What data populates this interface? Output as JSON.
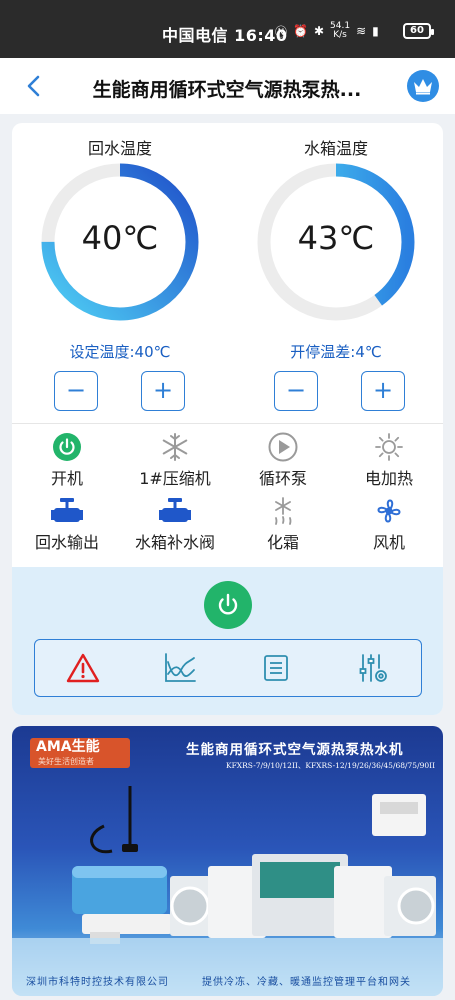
{
  "status_bar": {
    "carrier_time": "中国电信 16:40",
    "net_speed_top": "54.1",
    "net_speed_unit": "K/s",
    "battery": "60"
  },
  "nav": {
    "title": "生能商用循环式空气源热泵热..."
  },
  "gauges": {
    "left": {
      "label": "回水温度",
      "value": "40℃",
      "setting": "设定温度:40℃",
      "level": 0.75
    },
    "right": {
      "label": "水箱温度",
      "value": "43℃",
      "setting": "开停温差:4℃",
      "level": 0.4
    },
    "minus": "−",
    "plus": "+"
  },
  "status_items": [
    {
      "label": "开机",
      "icon": "power-on-icon"
    },
    {
      "label": "1#压缩机",
      "icon": "snowflake-icon"
    },
    {
      "label": "循环泵",
      "icon": "play-pump-icon"
    },
    {
      "label": "电加热",
      "icon": "sun-heater-icon"
    },
    {
      "label": "回水输出",
      "icon": "valve-icon"
    },
    {
      "label": "水箱补水阀",
      "icon": "valve-icon"
    },
    {
      "label": "化霜",
      "icon": "defrost-icon"
    },
    {
      "label": "风机",
      "icon": "fan-icon"
    }
  ],
  "banner": {
    "logo": "AMA生能",
    "logo_sub": "美好生活创造者",
    "title": "生能商用循环式空气源热泵热水机",
    "models": "KFXRS-7/9/10/12II、KFXRS-12/19/26/36/45/68/75/90II",
    "footer_left": "深圳市科特时控技术有限公司",
    "footer_right": "提供冷冻、冷藏、暖通监控管理平台和网关"
  },
  "colors": {
    "accent": "#2f7fd6",
    "power_green": "#22b46a",
    "alarm_red": "#e02020"
  }
}
